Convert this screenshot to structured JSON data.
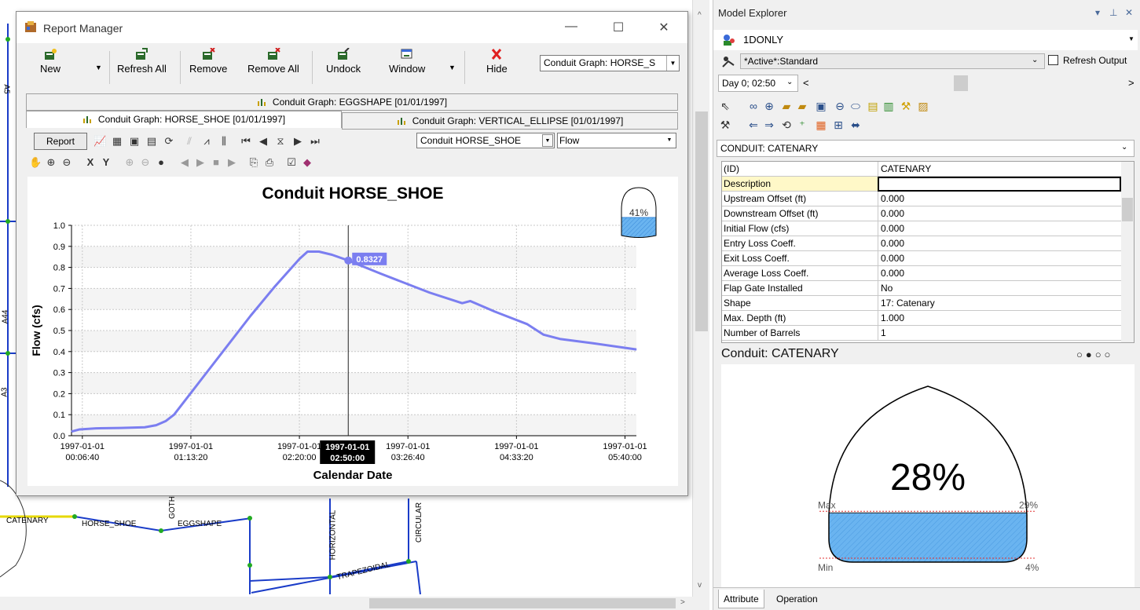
{
  "map": {
    "labels": [
      "A5",
      "A44",
      "A3",
      "CATENARY",
      "HORSE_SHOE",
      "EGGSHAPE",
      "GOTHIC",
      "HORIZONTAL",
      "CIRCULAR",
      "TRAPEZOIDAL"
    ]
  },
  "report_manager": {
    "title": "Report Manager",
    "toolbar": {
      "new": "New",
      "refresh_all": "Refresh All",
      "remove": "Remove",
      "remove_all": "Remove All",
      "undock": "Undock",
      "window": "Window",
      "hide": "Hide",
      "combo_value": "Conduit Graph: HORSE_S"
    },
    "tabs": [
      "Conduit Graph: EGGSHAPE [01/01/1997]",
      "Conduit Graph: HORSE_SHOE [01/01/1997]",
      "Conduit Graph: VERTICAL_ELLIPSE [01/01/1997]"
    ],
    "graph_toolbar": {
      "report_button": "Report",
      "conduit_select": "Conduit HORSE_SHOE",
      "variable_select": "Flow"
    }
  },
  "chart_data": {
    "type": "line",
    "title": "Conduit HORSE_SHOE",
    "xlabel": "Calendar Date",
    "ylabel": "Flow (cfs)",
    "ylim": [
      0.0,
      1.0
    ],
    "y_ticks": [
      "0.0",
      "0.1",
      "0.2",
      "0.3",
      "0.4",
      "0.5",
      "0.6",
      "0.7",
      "0.8",
      "0.9",
      "1.0"
    ],
    "x_ticks": [
      {
        "date": "1997-01-01",
        "time": "00:06:40",
        "minutes": 6.667
      },
      {
        "date": "1997-01-01",
        "time": "01:13:20",
        "minutes": 73.333
      },
      {
        "date": "1997-01-01",
        "time": "02:20:00",
        "minutes": 140
      },
      {
        "date": "1997-01-01",
        "time": "03:26:40",
        "minutes": 206.667
      },
      {
        "date": "1997-01-01",
        "time": "04:33:20",
        "minutes": 273.333
      },
      {
        "date": "1997-01-01",
        "time": "05:40:00",
        "minutes": 340
      }
    ],
    "x_range_minutes": [
      0,
      347
    ],
    "cursor": {
      "date": "1997-01-01",
      "time": "02:50:00",
      "minutes": 170,
      "value": "0.8327"
    },
    "fill_indicator": "41%",
    "grid": true,
    "series": [
      {
        "color": "#7b7ef0",
        "points_minutes": [
          0,
          5,
          15,
          30,
          45,
          52,
          58,
          63,
          70,
          80,
          95,
          110,
          125,
          140,
          145,
          152,
          160,
          170,
          190,
          200,
          220,
          240,
          245,
          260,
          280,
          290,
          300,
          320,
          347
        ],
        "values": [
          0.02,
          0.03,
          0.035,
          0.037,
          0.04,
          0.05,
          0.07,
          0.1,
          0.17,
          0.27,
          0.42,
          0.57,
          0.71,
          0.84,
          0.875,
          0.875,
          0.86,
          0.8327,
          0.77,
          0.74,
          0.68,
          0.63,
          0.64,
          0.59,
          0.53,
          0.48,
          0.46,
          0.44,
          0.41
        ]
      }
    ]
  },
  "model_explorer": {
    "title": "Model Explorer",
    "database": "1DONLY",
    "scenario": "*Active*:Standard",
    "refresh_output": "Refresh Output",
    "time": "Day 0;  02:50",
    "object_selector": "CONDUIT: CATENARY",
    "attributes": [
      {
        "k": "(ID)",
        "v": "CATENARY"
      },
      {
        "k": "Description",
        "v": ""
      },
      {
        "k": "Upstream Offset (ft)",
        "v": "0.000"
      },
      {
        "k": "Downstream Offset (ft)",
        "v": "0.000"
      },
      {
        "k": "Initial Flow (cfs)",
        "v": "0.000"
      },
      {
        "k": "Entry Loss Coeff.",
        "v": "0.000"
      },
      {
        "k": "Exit Loss Coeff.",
        "v": "0.000"
      },
      {
        "k": "Average Loss Coeff.",
        "v": "0.000"
      },
      {
        "k": "Flap Gate Installed",
        "v": "No"
      },
      {
        "k": "Shape",
        "v": "17: Catenary"
      },
      {
        "k": "Max. Depth (ft)",
        "v": "1.000"
      },
      {
        "k": "Number of Barrels",
        "v": "1"
      }
    ],
    "cross_section": {
      "title": "Conduit: CATENARY",
      "percent": "28%",
      "max_label": "Max",
      "max_value": "29%",
      "min_label": "Min",
      "min_value": "4%",
      "fill_fraction": 0.28,
      "fill_color": "#6ab4f0"
    },
    "bottom_tabs": [
      "Attribute",
      "Operation"
    ]
  }
}
